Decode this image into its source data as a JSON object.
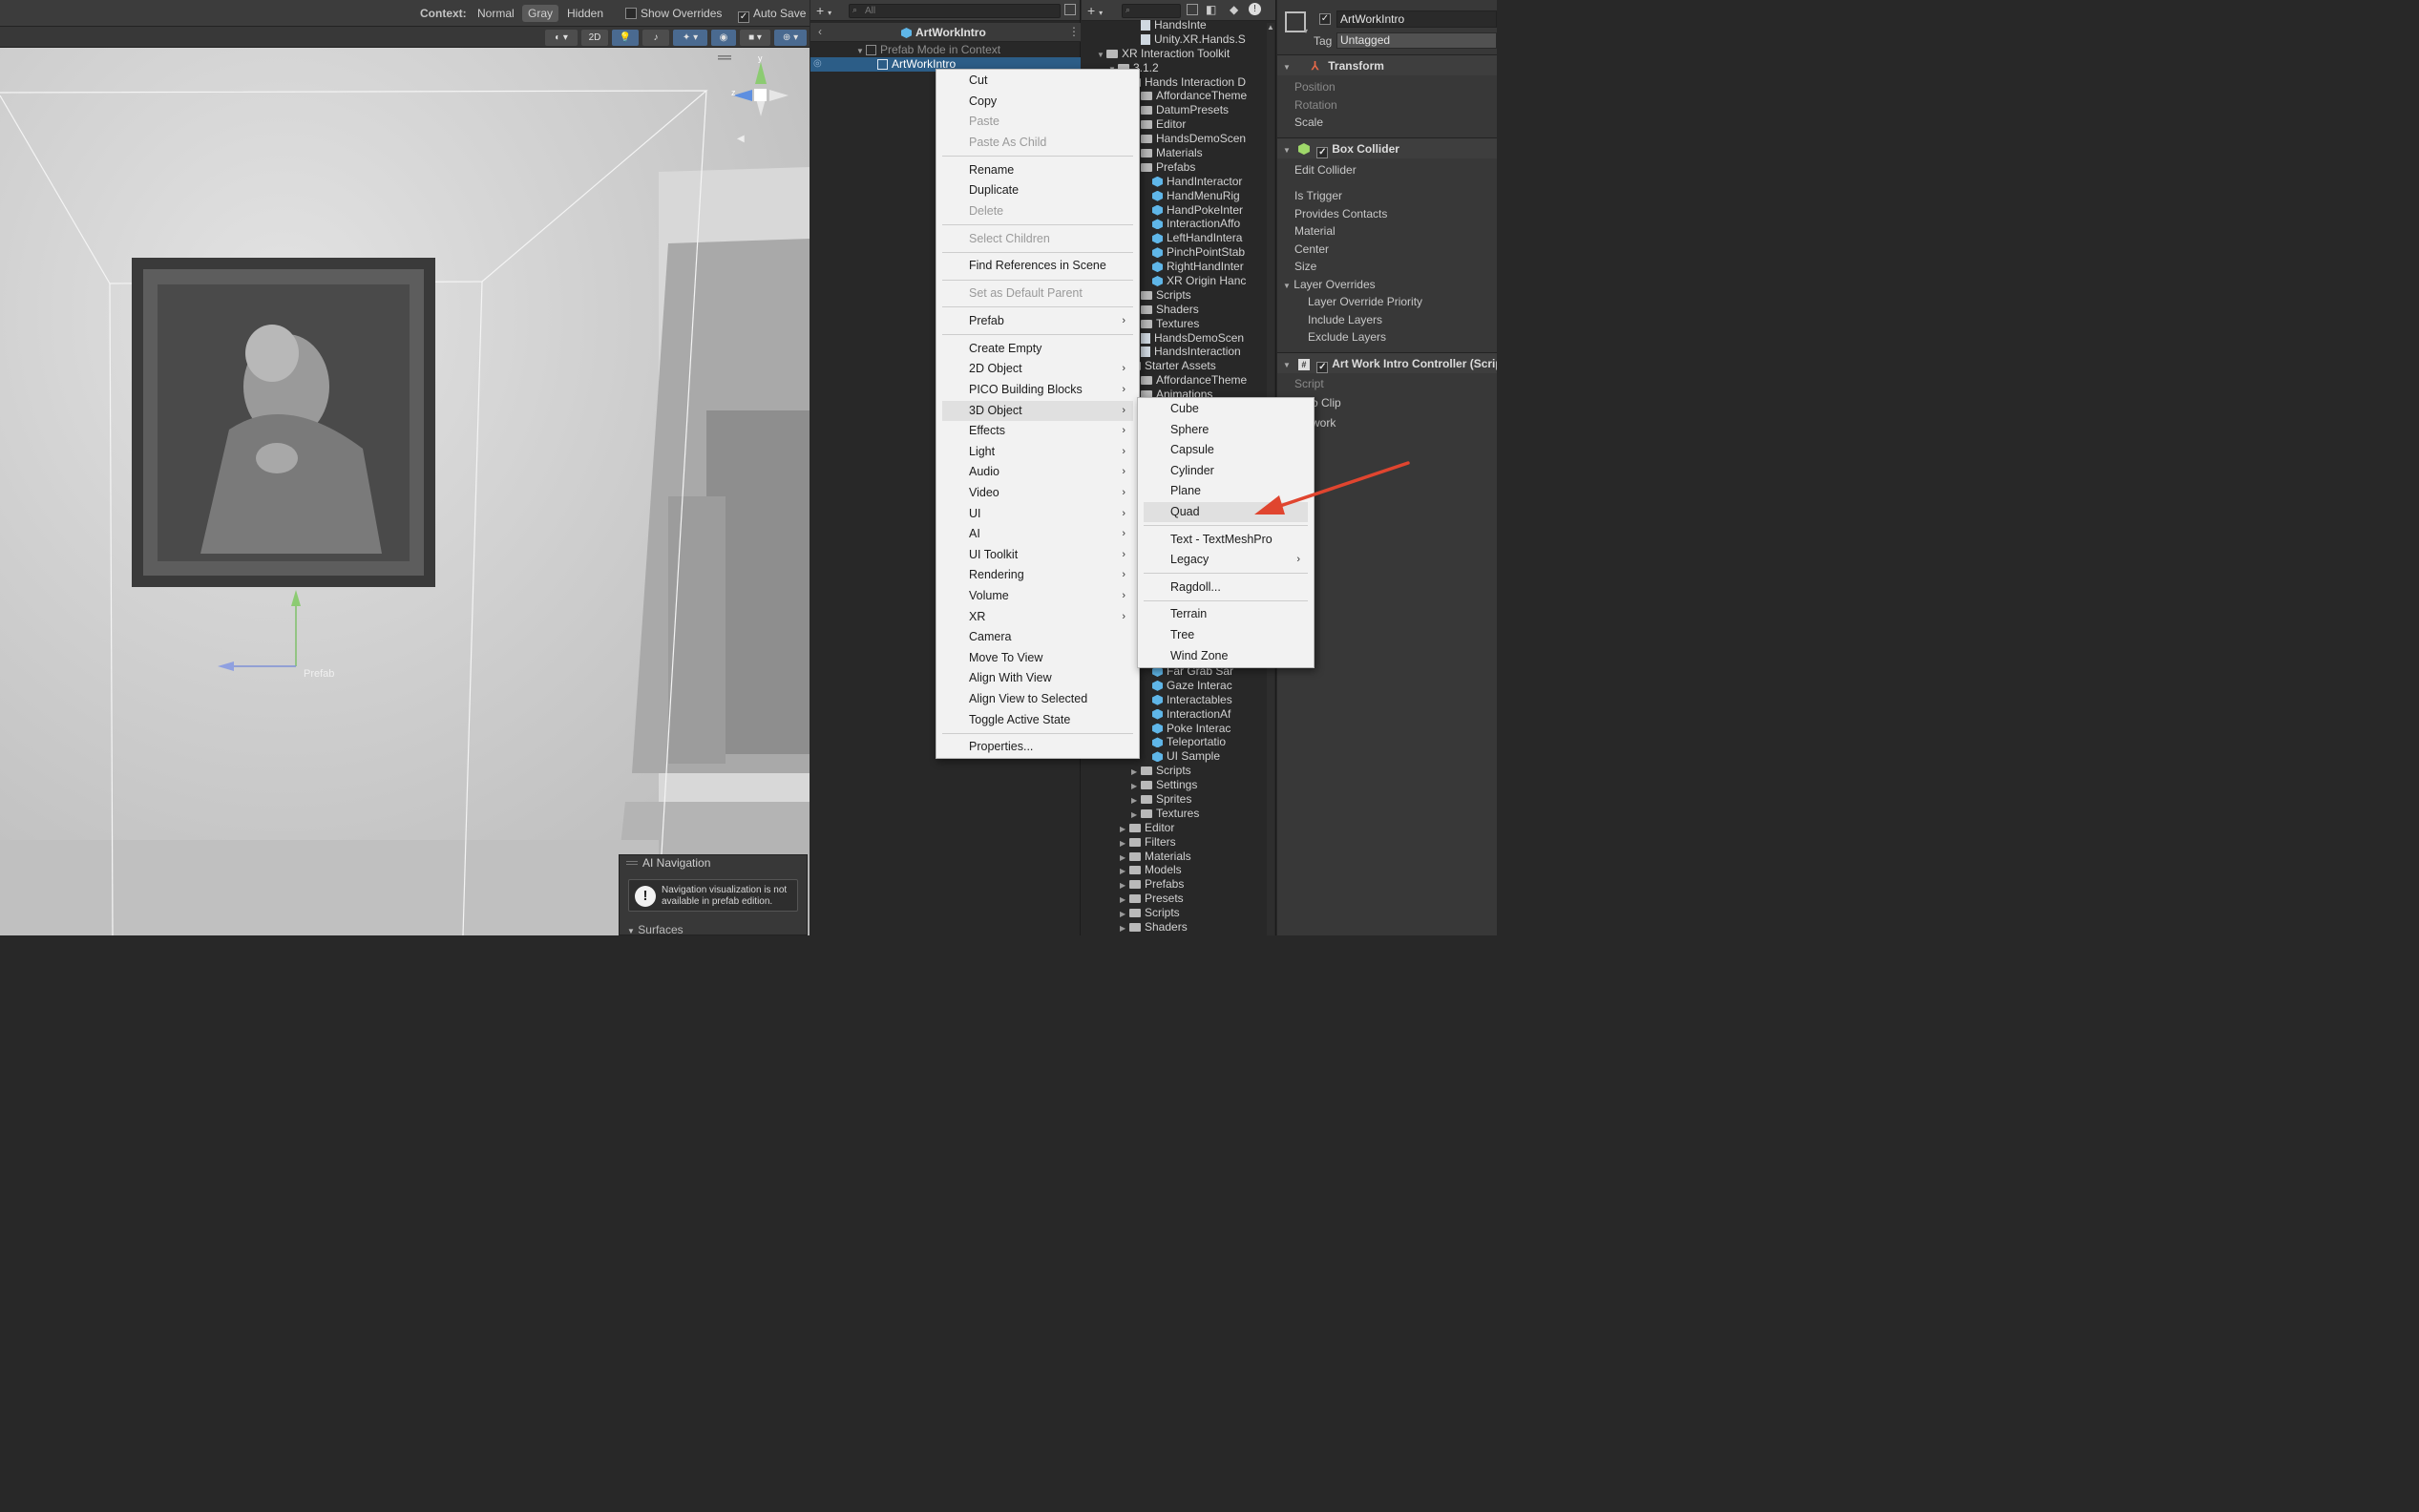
{
  "scene": {
    "context_label": "Context:",
    "context_options": [
      "Normal",
      "Gray",
      "Hidden"
    ],
    "context_selected": "Gray",
    "show_overrides": "Show Overrides",
    "auto_save": "Auto Save",
    "toolbar_2d": "2D",
    "prefab_label": "Prefab",
    "ai_navigation": {
      "title": "AI Navigation",
      "message": "Navigation visualization is not available in prefab edition.",
      "surfaces": "Surfaces"
    }
  },
  "hierarchy": {
    "search_placeholder": "All",
    "title": "ArtWorkIntro",
    "rows": [
      {
        "label": "Prefab Mode in Context",
        "dim": true
      },
      {
        "label": "ArtWorkIntro",
        "selected": true
      }
    ]
  },
  "project": {
    "rows": [
      {
        "label": "HandsInte",
        "indent": 4,
        "type": "file"
      },
      {
        "label": "Unity.XR.Hands.S",
        "indent": 4,
        "type": "file"
      },
      {
        "label": "XR Interaction Toolkit",
        "indent": 1,
        "type": "folder",
        "open": true
      },
      {
        "label": "3.1.2",
        "indent": 2,
        "type": "folder",
        "open": true
      },
      {
        "label": "Hands Interaction D",
        "indent": 3,
        "type": "folder",
        "open": true
      },
      {
        "label": "AffordanceTheme",
        "indent": 4,
        "type": "folder"
      },
      {
        "label": "DatumPresets",
        "indent": 4,
        "type": "folder"
      },
      {
        "label": "Editor",
        "indent": 4,
        "type": "folder"
      },
      {
        "label": "HandsDemoScen",
        "indent": 4,
        "type": "folder"
      },
      {
        "label": "Materials",
        "indent": 4,
        "type": "folder"
      },
      {
        "label": "Prefabs",
        "indent": 4,
        "type": "folder",
        "open": true
      },
      {
        "label": "HandInteractor",
        "indent": 5,
        "type": "prefab"
      },
      {
        "label": "HandMenuRig",
        "indent": 5,
        "type": "prefab"
      },
      {
        "label": "HandPokeInter",
        "indent": 5,
        "type": "prefab"
      },
      {
        "label": "InteractionAffo",
        "indent": 5,
        "type": "prefab"
      },
      {
        "label": "LeftHandIntera",
        "indent": 5,
        "type": "prefab"
      },
      {
        "label": "PinchPointStab",
        "indent": 5,
        "type": "prefab"
      },
      {
        "label": "RightHandInter",
        "indent": 5,
        "type": "prefab"
      },
      {
        "label": "XR Origin Hanc",
        "indent": 5,
        "type": "prefab"
      },
      {
        "label": "Scripts",
        "indent": 4,
        "type": "folder"
      },
      {
        "label": "Shaders",
        "indent": 4,
        "type": "folder"
      },
      {
        "label": "Textures",
        "indent": 4,
        "type": "folder"
      },
      {
        "label": "HandsDemoScen",
        "indent": 4,
        "type": "file"
      },
      {
        "label": "HandsInteraction",
        "indent": 4,
        "type": "file"
      },
      {
        "label": "Starter Assets",
        "indent": 3,
        "type": "folder",
        "open": true
      },
      {
        "label": "AffordanceTheme",
        "indent": 4,
        "type": "folder"
      },
      {
        "label": "Animations",
        "indent": 4,
        "type": "folder"
      }
    ],
    "rows_bottom": [
      {
        "label": "Far Grab Sar",
        "indent": 5,
        "type": "prefab"
      },
      {
        "label": "Gaze Interac",
        "indent": 5,
        "type": "prefab"
      },
      {
        "label": "Interactables",
        "indent": 5,
        "type": "prefab"
      },
      {
        "label": "InteractionAf",
        "indent": 5,
        "type": "prefab"
      },
      {
        "label": "Poke Interac",
        "indent": 5,
        "type": "prefab"
      },
      {
        "label": "Teleportatio",
        "indent": 5,
        "type": "prefab"
      },
      {
        "label": "UI Sample",
        "indent": 5,
        "type": "prefab"
      },
      {
        "label": "Scripts",
        "indent": 4,
        "type": "folder"
      },
      {
        "label": "Settings",
        "indent": 4,
        "type": "folder"
      },
      {
        "label": "Sprites",
        "indent": 4,
        "type": "folder"
      },
      {
        "label": "Textures",
        "indent": 4,
        "type": "folder"
      },
      {
        "label": "Editor",
        "indent": 3,
        "type": "folder"
      },
      {
        "label": "Filters",
        "indent": 3,
        "type": "folder"
      },
      {
        "label": "Materials",
        "indent": 3,
        "type": "folder"
      },
      {
        "label": "Models",
        "indent": 3,
        "type": "folder"
      },
      {
        "label": "Prefabs",
        "indent": 3,
        "type": "folder"
      },
      {
        "label": "Presets",
        "indent": 3,
        "type": "folder"
      },
      {
        "label": "Scripts",
        "indent": 3,
        "type": "folder"
      },
      {
        "label": "Shaders",
        "indent": 3,
        "type": "folder"
      }
    ]
  },
  "context_menu": {
    "items": [
      {
        "label": "Cut"
      },
      {
        "label": "Copy"
      },
      {
        "label": "Paste",
        "disabled": true
      },
      {
        "label": "Paste As Child",
        "disabled": true
      },
      {
        "sep": true
      },
      {
        "label": "Rename"
      },
      {
        "label": "Duplicate"
      },
      {
        "label": "Delete",
        "disabled": true
      },
      {
        "sep": true
      },
      {
        "label": "Select Children",
        "disabled": true
      },
      {
        "sep": true
      },
      {
        "label": "Find References in Scene"
      },
      {
        "sep": true
      },
      {
        "label": "Set as Default Parent",
        "disabled": true
      },
      {
        "sep": true
      },
      {
        "label": "Prefab",
        "submenu": true
      },
      {
        "sep": true
      },
      {
        "label": "Create Empty"
      },
      {
        "label": "2D Object",
        "submenu": true
      },
      {
        "label": "PICO Building Blocks",
        "submenu": true
      },
      {
        "label": "3D Object",
        "submenu": true,
        "highlighted": true
      },
      {
        "label": "Effects",
        "submenu": true
      },
      {
        "label": "Light",
        "submenu": true
      },
      {
        "label": "Audio",
        "submenu": true
      },
      {
        "label": "Video",
        "submenu": true
      },
      {
        "label": "UI",
        "submenu": true
      },
      {
        "label": "AI",
        "submenu": true
      },
      {
        "label": "UI Toolkit",
        "submenu": true
      },
      {
        "label": "Rendering",
        "submenu": true
      },
      {
        "label": "Volume",
        "submenu": true
      },
      {
        "label": "XR",
        "submenu": true
      },
      {
        "label": "Camera"
      },
      {
        "label": "Move To View"
      },
      {
        "label": "Align With View"
      },
      {
        "label": "Align View to Selected"
      },
      {
        "label": "Toggle Active State"
      },
      {
        "sep": true
      },
      {
        "label": "Properties..."
      }
    ]
  },
  "submenu_3d": {
    "items": [
      {
        "label": "Cube"
      },
      {
        "label": "Sphere"
      },
      {
        "label": "Capsule"
      },
      {
        "label": "Cylinder"
      },
      {
        "label": "Plane"
      },
      {
        "label": "Quad",
        "highlighted": true
      },
      {
        "sep": true
      },
      {
        "label": "Text - TextMeshPro"
      },
      {
        "label": "Legacy",
        "submenu": true
      },
      {
        "sep": true
      },
      {
        "label": "Ragdoll..."
      },
      {
        "sep": true
      },
      {
        "label": "Terrain"
      },
      {
        "label": "Tree"
      },
      {
        "label": "Wind Zone"
      }
    ]
  },
  "inspector": {
    "object_name": "ArtWorkIntro",
    "tag_label": "Tag",
    "tag_value": "Untagged",
    "transform": {
      "title": "Transform",
      "fields": [
        "Position",
        "Rotation",
        "Scale"
      ]
    },
    "box_collider": {
      "title": "Box Collider",
      "fields": [
        "Edit Collider",
        "Is Trigger",
        "Provides Contacts",
        "Material",
        "Center",
        "Size"
      ],
      "layer_overrides": "Layer Overrides",
      "layer_fields": [
        "Layer Override Priority",
        "Include Layers",
        "Exclude Layers"
      ]
    },
    "controller": {
      "title": "Art Work Intro Controller (Scrip",
      "fields": [
        "Script",
        "o Clip",
        "work"
      ]
    }
  },
  "colors": {
    "accent": "#2c5d87",
    "annotation_arrow": "#e0452f"
  }
}
